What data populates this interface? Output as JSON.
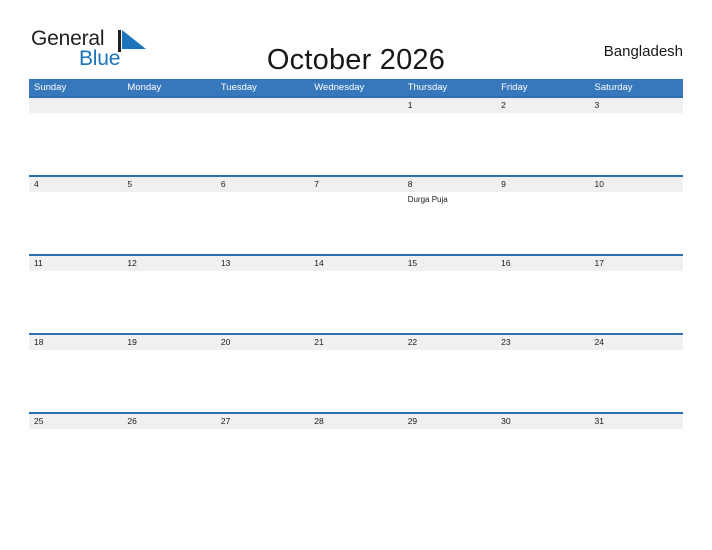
{
  "brand": {
    "name_part1": "General",
    "name_part2": "Blue",
    "mark": "triangle-icon",
    "accent_color": "#1b75bb"
  },
  "header": {
    "title": "October 2026",
    "country": "Bangladesh"
  },
  "calendar": {
    "header_bg": "#3778bd",
    "row_border": "#2f6fae",
    "day_band_bg": "#f0f0f0",
    "weekdays": [
      "Sunday",
      "Monday",
      "Tuesday",
      "Wednesday",
      "Thursday",
      "Friday",
      "Saturday"
    ],
    "weeks": [
      [
        {
          "day": "",
          "events": []
        },
        {
          "day": "",
          "events": []
        },
        {
          "day": "",
          "events": []
        },
        {
          "day": "",
          "events": []
        },
        {
          "day": "1",
          "events": []
        },
        {
          "day": "2",
          "events": []
        },
        {
          "day": "3",
          "events": []
        }
      ],
      [
        {
          "day": "4",
          "events": []
        },
        {
          "day": "5",
          "events": []
        },
        {
          "day": "6",
          "events": []
        },
        {
          "day": "7",
          "events": []
        },
        {
          "day": "8",
          "events": [
            "Durga Puja"
          ]
        },
        {
          "day": "9",
          "events": []
        },
        {
          "day": "10",
          "events": []
        }
      ],
      [
        {
          "day": "11",
          "events": []
        },
        {
          "day": "12",
          "events": []
        },
        {
          "day": "13",
          "events": []
        },
        {
          "day": "14",
          "events": []
        },
        {
          "day": "15",
          "events": []
        },
        {
          "day": "16",
          "events": []
        },
        {
          "day": "17",
          "events": []
        }
      ],
      [
        {
          "day": "18",
          "events": []
        },
        {
          "day": "19",
          "events": []
        },
        {
          "day": "20",
          "events": []
        },
        {
          "day": "21",
          "events": []
        },
        {
          "day": "22",
          "events": []
        },
        {
          "day": "23",
          "events": []
        },
        {
          "day": "24",
          "events": []
        }
      ],
      [
        {
          "day": "25",
          "events": []
        },
        {
          "day": "26",
          "events": []
        },
        {
          "day": "27",
          "events": []
        },
        {
          "day": "28",
          "events": []
        },
        {
          "day": "29",
          "events": []
        },
        {
          "day": "30",
          "events": []
        },
        {
          "day": "31",
          "events": []
        }
      ]
    ]
  }
}
